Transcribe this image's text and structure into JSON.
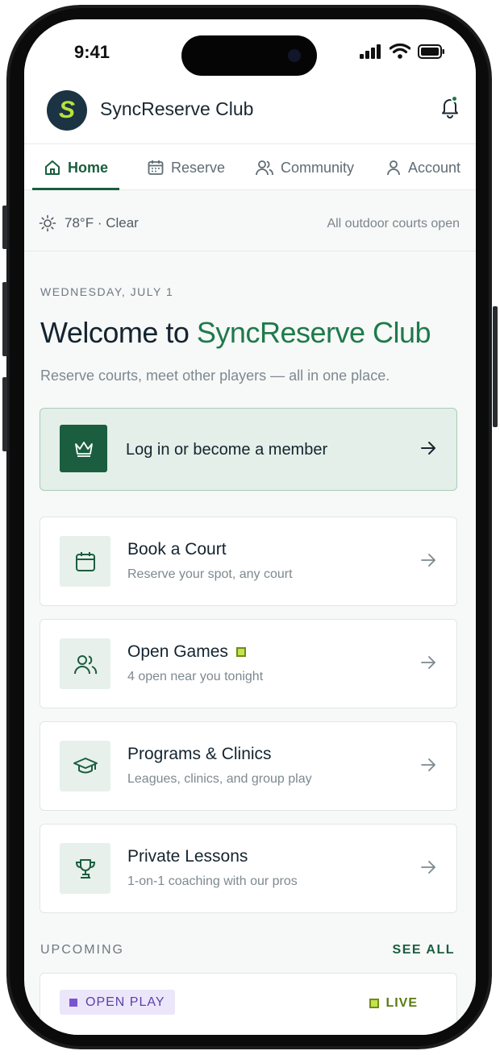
{
  "status_bar": {
    "time": "9:41"
  },
  "header": {
    "logo_letter": "S",
    "app_title": "SyncReserve Club"
  },
  "tabs": [
    {
      "label": "Home",
      "icon": "home-icon",
      "active": true
    },
    {
      "label": "Reserve",
      "icon": "calendar-icon",
      "active": false
    },
    {
      "label": "Community",
      "icon": "users-icon",
      "active": false
    },
    {
      "label": "Account",
      "icon": "user-icon",
      "active": false
    }
  ],
  "weather": {
    "summary": "78°F · Clear",
    "icon": "sun-icon",
    "court_status": "All outdoor courts open"
  },
  "welcome": {
    "date": "WEDNESDAY, JULY 1",
    "title_prefix": "Welcome to ",
    "title_accent": "SyncReserve Club",
    "subtitle": "Reserve courts, meet other players — all in one place."
  },
  "cta": {
    "label": "Log in or become a member",
    "icon": "crown-icon"
  },
  "actions": [
    {
      "title": "Book a Court",
      "subtitle": "Reserve your spot, any court",
      "icon": "calendar-icon"
    },
    {
      "title": "Open Games",
      "subtitle": "4 open near you tonight",
      "icon": "users-icon",
      "indicator": true
    },
    {
      "title": "Programs & Clinics",
      "subtitle": "Leagues, clinics, and group play",
      "icon": "graduation-cap-icon"
    },
    {
      "title": "Private Lessons",
      "subtitle": "1-on-1 coaching with our pros",
      "icon": "trophy-icon"
    }
  ],
  "upcoming": {
    "heading": "UPCOMING",
    "see_all": "SEE ALL",
    "event": {
      "type_badge": "OPEN PLAY",
      "status_badge": "LIVE"
    }
  },
  "colors": {
    "brand_green": "#1a5e3f",
    "accent_green": "#1e7a4a",
    "lime": "#c4e34a",
    "navy": "#1c3344",
    "purple": "#7a55cf"
  }
}
